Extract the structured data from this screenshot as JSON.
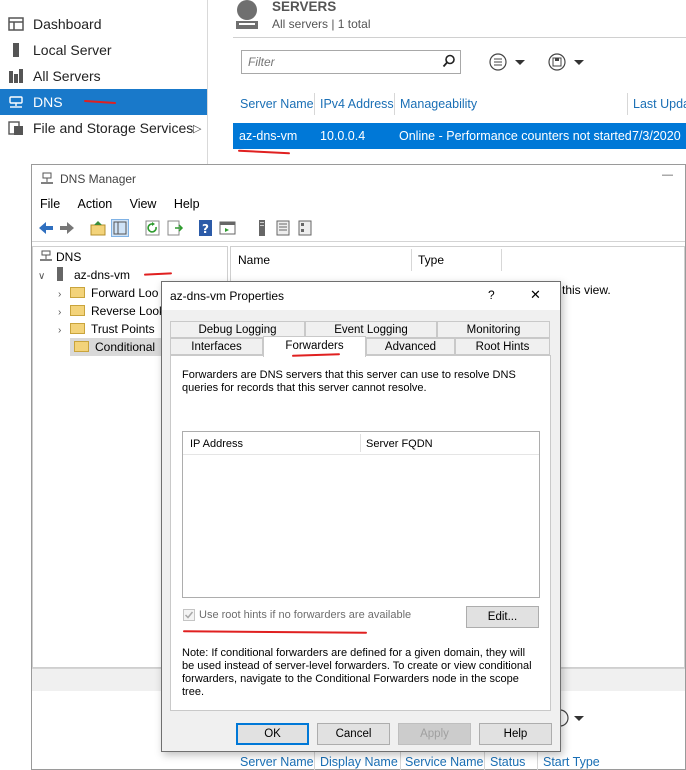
{
  "server_manager": {
    "nav": [
      {
        "label": "Dashboard",
        "icon": "dashboard-icon"
      },
      {
        "label": "Local Server",
        "icon": "local-server-icon"
      },
      {
        "label": "All Servers",
        "icon": "all-servers-icon"
      },
      {
        "label": "DNS",
        "icon": "dns-icon",
        "active": true
      },
      {
        "label": "File and Storage Services",
        "icon": "file-storage-icon",
        "chevron": "▷"
      }
    ],
    "servers": {
      "title": "SERVERS",
      "subtitle": "All servers | 1 total",
      "filter_placeholder": "Filter",
      "columns": [
        "Server Name",
        "IPv4 Address",
        "Manageability",
        "Last Upda"
      ],
      "rows": [
        {
          "server_name": "az-dns-vm",
          "ipv4": "10.0.0.4",
          "manageability": "Online - Performance counters not started",
          "last_update": "7/3/2020"
        }
      ]
    },
    "services": {
      "columns": [
        "Server Name",
        "Display Name",
        "Service Name",
        "Status",
        "Start Type"
      ]
    }
  },
  "dns_manager": {
    "title": "DNS Manager",
    "minimize": "—",
    "menu": [
      "File",
      "Action",
      "View",
      "Help"
    ],
    "tree": {
      "root": "DNS",
      "server": "az-dns-vm",
      "children": [
        "Forward Loo",
        "Reverse Look",
        "Trust Points",
        "Conditional"
      ]
    },
    "list_columns": [
      "Name",
      "Type"
    ],
    "empty_text": "this view."
  },
  "dialog": {
    "title": "az-dns-vm Properties",
    "help": "?",
    "close": "✕",
    "tabs_row1": [
      "Debug Logging",
      "Event Logging",
      "Monitoring"
    ],
    "tabs_row2": [
      "Interfaces",
      "Forwarders",
      "Advanced",
      "Root Hints"
    ],
    "selected_tab": "Forwarders",
    "description": "Forwarders are DNS servers that this server can use to resolve DNS queries for records that this server cannot resolve.",
    "table_columns": [
      "IP Address",
      "Server FQDN"
    ],
    "checkbox_label": "Use root hints if no forwarders are available",
    "checkbox_checked": true,
    "edit_button": "Edit...",
    "note": "Note: If conditional forwarders are defined for a given domain, they will be used instead of server-level forwarders.  To create or view conditional forwarders, navigate to the Conditional Forwarders node in the scope tree.",
    "buttons": {
      "ok": "OK",
      "cancel": "Cancel",
      "apply": "Apply",
      "help": "Help"
    }
  },
  "colors": {
    "accent": "#1979ca",
    "selection": "#0078d7",
    "annotation": "#e02020"
  }
}
